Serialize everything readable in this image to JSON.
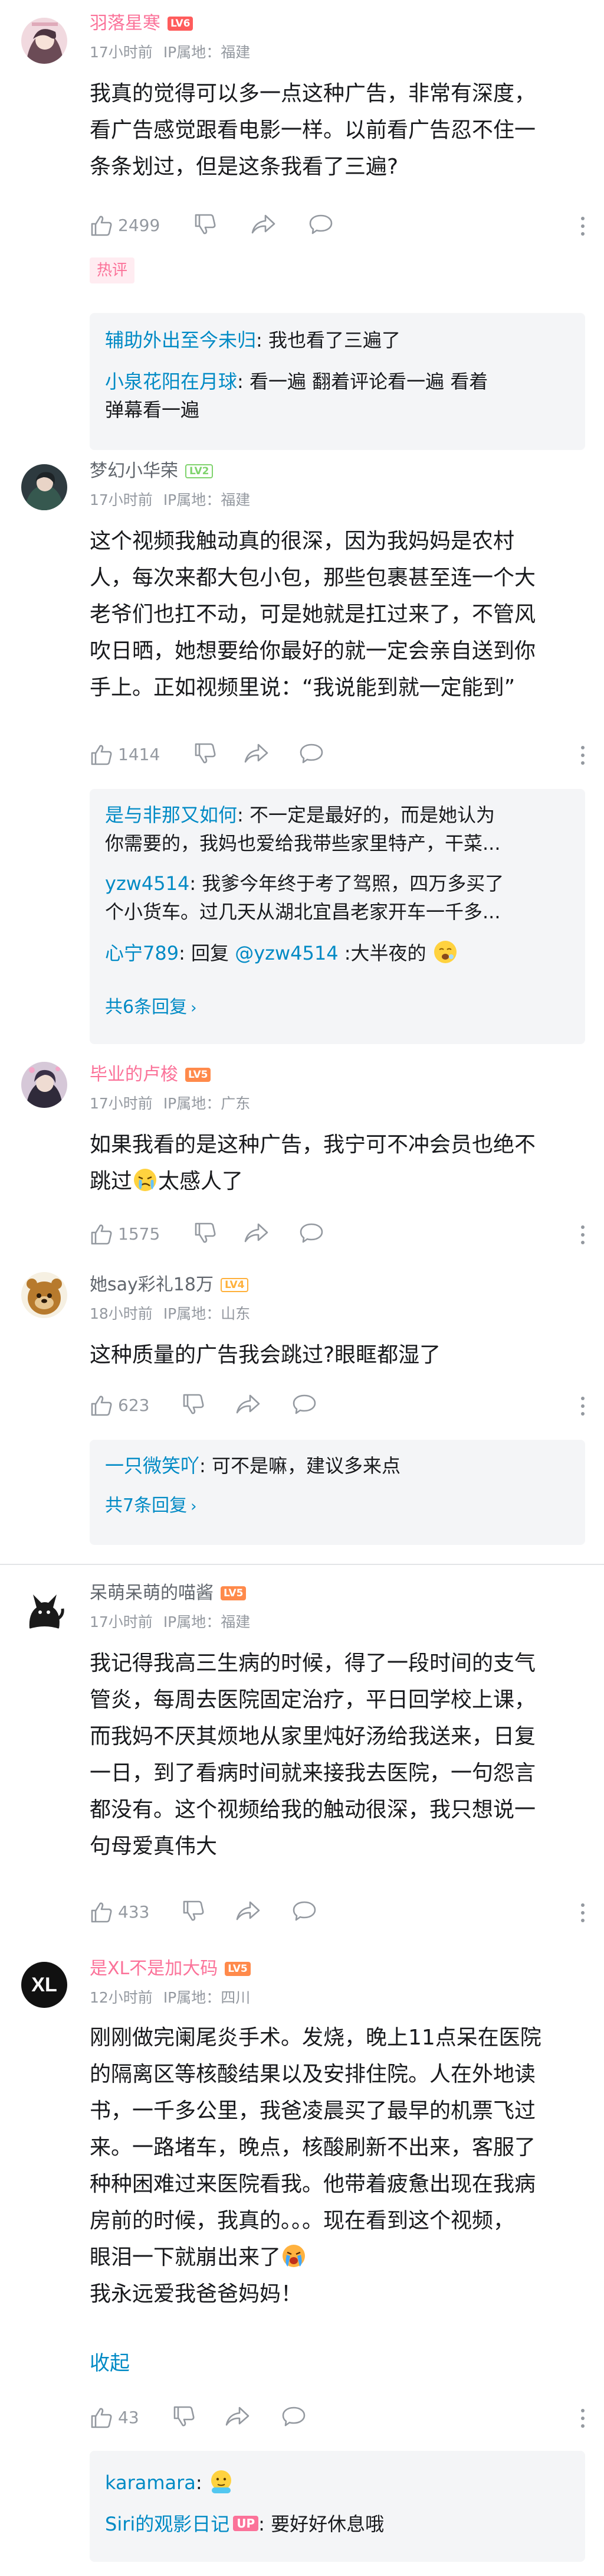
{
  "comments": [
    {
      "username": "羽落星寒",
      "level": "LV6",
      "time": "17小时前",
      "ip": "IP属地：福建",
      "lines": [
        "我真的觉得可以多一点这种广告，非常有深度，",
        "看广告感觉跟看电影一样。以前看广告忍不住一",
        "条条划过，但是这条我看了三遍?"
      ],
      "likes": "2499",
      "hot_tag": "热评",
      "replies": [
        {
          "user": "辅助外出至今未归",
          "text": ": 我也看了三遍了"
        },
        {
          "user": "小泉花阳在月球",
          "text": ": 看一遍  翻着评论看一遍  看着",
          "text2": "弹幕看一遍"
        }
      ]
    },
    {
      "username": "梦幻小华荣",
      "level": "LV2",
      "time": "17小时前",
      "ip": "IP属地：福建",
      "lines": [
        "这个视频我触动真的很深，因为我妈妈是农村",
        "人，每次来都大包小包，那些包裹甚至连一个大",
        "老爷们也扛不动，可是她就是扛过来了，不管风",
        "吹日晒，她想要给你最好的就一定会亲自送到你",
        "手上。正如视频里说：“我说能到就一定能到”"
      ],
      "likes": "1414",
      "replies": [
        {
          "user": "是与非那又如何",
          "text": ": 不一定是最好的，而是她认为",
          "text2": "你需要的，我妈也爱给我带些家里特产，干菜..."
        },
        {
          "user": "yzw4514",
          "text": ": 我爹今年终于考了驾照，四万多买了",
          "text2": "个小货车。过几天从湖北宜昌老家开车一千多..."
        },
        {
          "user": "心宁789",
          "text": ": 回复 ",
          "at": "@yzw4514",
          "text3": " :大半夜的"
        }
      ],
      "more_replies": "共6条回复"
    },
    {
      "username": "毕业的卢梭",
      "level": "LV5",
      "time": "17小时前",
      "ip": "IP属地：广东",
      "lines": [
        "如果我看的是这种广告，我宁可不冲会员也绝不",
        "跳过",
        "太感人了"
      ],
      "likes": "1575"
    },
    {
      "username": "她say彩礼18万",
      "level": "LV4",
      "time": "18小时前",
      "ip": "IP属地：山东",
      "lines": [
        "这种质量的广告我会跳过?眼眶都湿了"
      ],
      "likes": "623",
      "replies": [
        {
          "user": "一只微笑吖",
          "text": ": 可不是嘛，建议多来点"
        }
      ],
      "more_replies": "共7条回复"
    },
    {
      "username": "呆萌呆萌的喵酱",
      "level": "LV5",
      "time": "17小时前",
      "ip": "IP属地：福建",
      "lines": [
        "我记得我高三生病的时候，得了一段时间的支气",
        "管炎，每周去医院固定治疗，平日回学校上课，",
        "而我妈不厌其烦地从家里炖好汤给我送来，日复",
        "一日，到了看病时间就来接我去医院，一句怨言",
        "都没有。这个视频给我的触动很深，我只想说一",
        "句母爱真伟大"
      ],
      "likes": "433"
    },
    {
      "username": "是XL不是加大码",
      "level": "LV5",
      "time": "12小时前",
      "ip": "IP属地：四川",
      "lines": [
        "刚刚做完阑尾炎手术。发烧，晚上11点呆在医院",
        "的隔离区等核酸结果以及安排住院。人在外地读",
        "书，一千多公里，我爸凌晨买了最早的机票飞过",
        "来。一路堵车，晚点，核酸刷新不出来，客服了",
        "种种困难过来医院看我。他带着疲惫出现在我病",
        "房前的时候，我真的。。。现在看到这个视频，",
        "眼泪一下就崩出来了",
        "我永远爱我爸爸妈妈！"
      ],
      "collapse": "收起",
      "likes": "43",
      "replies": [
        {
          "user": "karamara",
          "text": ":"
        },
        {
          "user": "Siri的观影日记",
          "badge": "UP",
          "text": ": 要好好休息哦"
        }
      ]
    }
  ],
  "colors": {
    "pink": "#fb7299",
    "blue": "#008ac5",
    "gray": "#9499a0"
  }
}
